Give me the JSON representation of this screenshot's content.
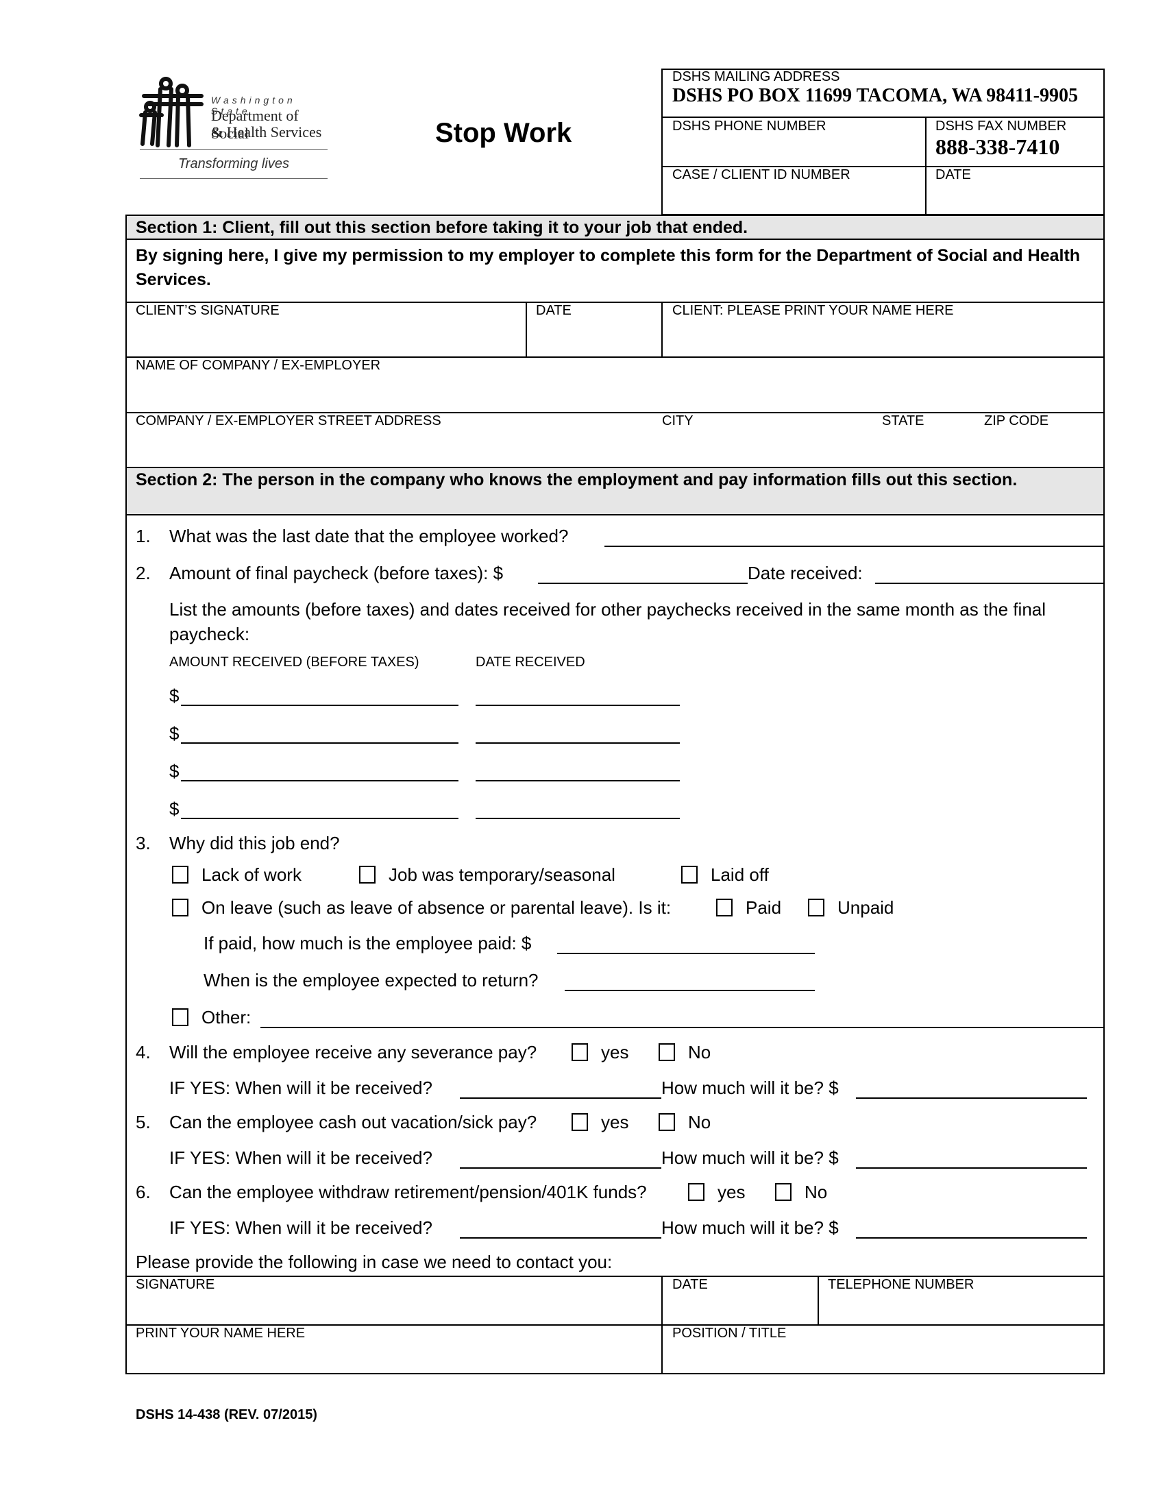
{
  "logo": {
    "state": "Washington State",
    "agency_line1": "Department of Social",
    "agency_line2": "& Health Services",
    "tagline": "Transforming lives"
  },
  "title": "Stop Work",
  "header": {
    "mailing_label": "DSHS MAILING ADDRESS",
    "mailing_value": "DSHS PO BOX 11699 TACOMA, WA 98411-9905",
    "phone_label": "DSHS PHONE NUMBER",
    "fax_label": "DSHS FAX NUMBER",
    "fax_value": "888-338-7410",
    "case_label": "CASE / CLIENT ID NUMBER",
    "date_label": "DATE"
  },
  "section1": {
    "heading": "Section 1:  Client, fill out this section before taking it to your job that ended.",
    "permission": "By signing here, I give my permission to my employer to complete this form for the Department of Social and Health Services.",
    "client_signature_label": "CLIENT’S SIGNATURE",
    "date_label": "DATE",
    "client_name_label": "CLIENT:  PLEASE PRINT YOUR NAME HERE",
    "company_label": "NAME OF COMPANY / EX-EMPLOYER",
    "street_label": "COMPANY / EX-EMPLOYER STREET ADDRESS",
    "city_label": "CITY",
    "state_label": "STATE",
    "zip_label": "ZIP CODE"
  },
  "section2": {
    "heading": "Section 2:  The person in the company who knows the employment and pay information fills out this section.",
    "q1_num": "1.",
    "q1": "What was the last date that the employee worked?",
    "q2_num": "2.",
    "q2": "Amount of final paycheck (before taxes):  $",
    "q2_date": "Date received:",
    "q2_list_intro": "List the amounts (before taxes) and dates received for other paychecks received in the same month as the final paycheck:",
    "amount_col": "AMOUNT RECEIVED (BEFORE TAXES)",
    "date_col": "DATE RECEIVED",
    "currency": "$",
    "paycheck_rows": [
      {
        "amount": "",
        "date": ""
      },
      {
        "amount": "",
        "date": ""
      },
      {
        "amount": "",
        "date": ""
      },
      {
        "amount": "",
        "date": ""
      }
    ],
    "q3_num": "3.",
    "q3": "Why did this job end?",
    "q3_options": {
      "lack_of_work": "Lack of work",
      "temporary": "Job was temporary/seasonal",
      "laid_off": "Laid off",
      "on_leave": "On leave (such as leave of absence or parental leave).  Is it:",
      "paid": "Paid",
      "unpaid": "Unpaid",
      "if_paid": "If paid, how much is the employee paid:  $",
      "return": "When is the employee expected to return?",
      "other": "Other:"
    },
    "q4_num": "4.",
    "q4": "Will the employee receive any severance pay?",
    "q5_num": "5.",
    "q5": "Can the employee cash out vacation/sick pay?",
    "q6_num": "6.",
    "q6": "Can the employee withdraw retirement/pension/401K funds?",
    "yes": "yes",
    "no": "No",
    "if_yes_when": "IF YES:  When will it be received?",
    "how_much": "How much will it be?  $",
    "contact_intro": "Please provide the following in case we need to contact you:",
    "signature_label": "SIGNATURE",
    "date_label": "DATE",
    "telephone_label": "TELEPHONE NUMBER",
    "print_name_label": "PRINT YOUR NAME HERE",
    "position_label": "POSITION / TITLE"
  },
  "footer": "DSHS 14-438 (REV. 07/2015)"
}
